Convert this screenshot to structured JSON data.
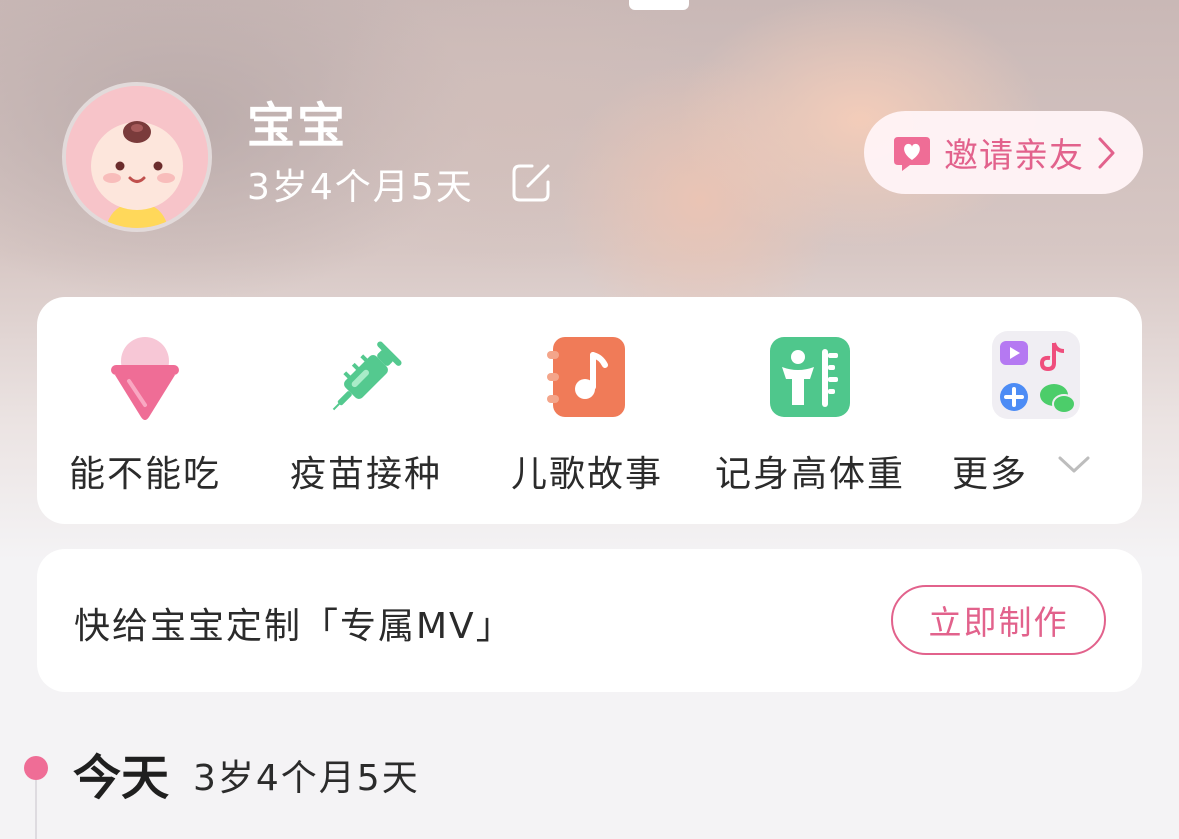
{
  "profile": {
    "name": "宝宝",
    "age": "3岁4个月5天"
  },
  "invite": {
    "label": "邀请亲友"
  },
  "tools": [
    {
      "label": "能不能吃",
      "icon": "ice-cream-icon"
    },
    {
      "label": "疫苗接种",
      "icon": "vaccine-syringe-icon"
    },
    {
      "label": "儿歌故事",
      "icon": "music-book-icon"
    },
    {
      "label": "记身高体重",
      "icon": "height-ruler-icon"
    },
    {
      "label": "更多",
      "icon": "more-apps-icon"
    }
  ],
  "mv": {
    "text": "快给宝宝定制「专属MV」",
    "button": "立即制作"
  },
  "timeline": {
    "title": "今天",
    "age": "3岁4个月5天"
  },
  "colors": {
    "accent": "#e2628c",
    "dot": "#ef6d96"
  }
}
